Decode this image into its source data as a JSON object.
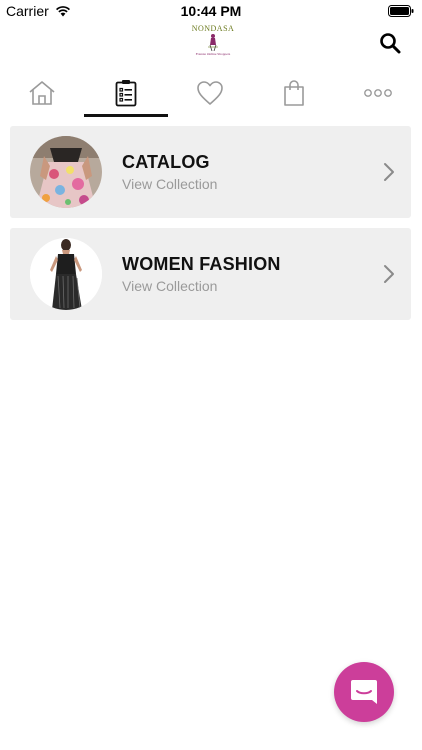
{
  "status_bar": {
    "carrier": "Carrier",
    "time": "10:44 PM"
  },
  "header": {
    "logo_title": "NONDASA",
    "logo_subtitle": "Fransie Online Shoppers",
    "search_icon": "search-icon"
  },
  "tabs": [
    {
      "name": "home",
      "icon": "home-icon",
      "active": false
    },
    {
      "name": "catalog",
      "icon": "clipboard-list-icon",
      "active": true
    },
    {
      "name": "wishlist",
      "icon": "heart-icon",
      "active": false
    },
    {
      "name": "bag",
      "icon": "shopping-bag-icon",
      "active": false
    },
    {
      "name": "more",
      "icon": "more-dots-icon",
      "active": false
    }
  ],
  "collections": [
    {
      "title": "CATALOG",
      "subtitle": "View Collection"
    },
    {
      "title": "WOMEN FASHION",
      "subtitle": "View Collection"
    }
  ],
  "colors": {
    "accent": "#cc3e9a",
    "row_background": "#efefef",
    "subtitle": "#9a9a9a"
  },
  "chat_button": {
    "icon": "chat-icon"
  }
}
